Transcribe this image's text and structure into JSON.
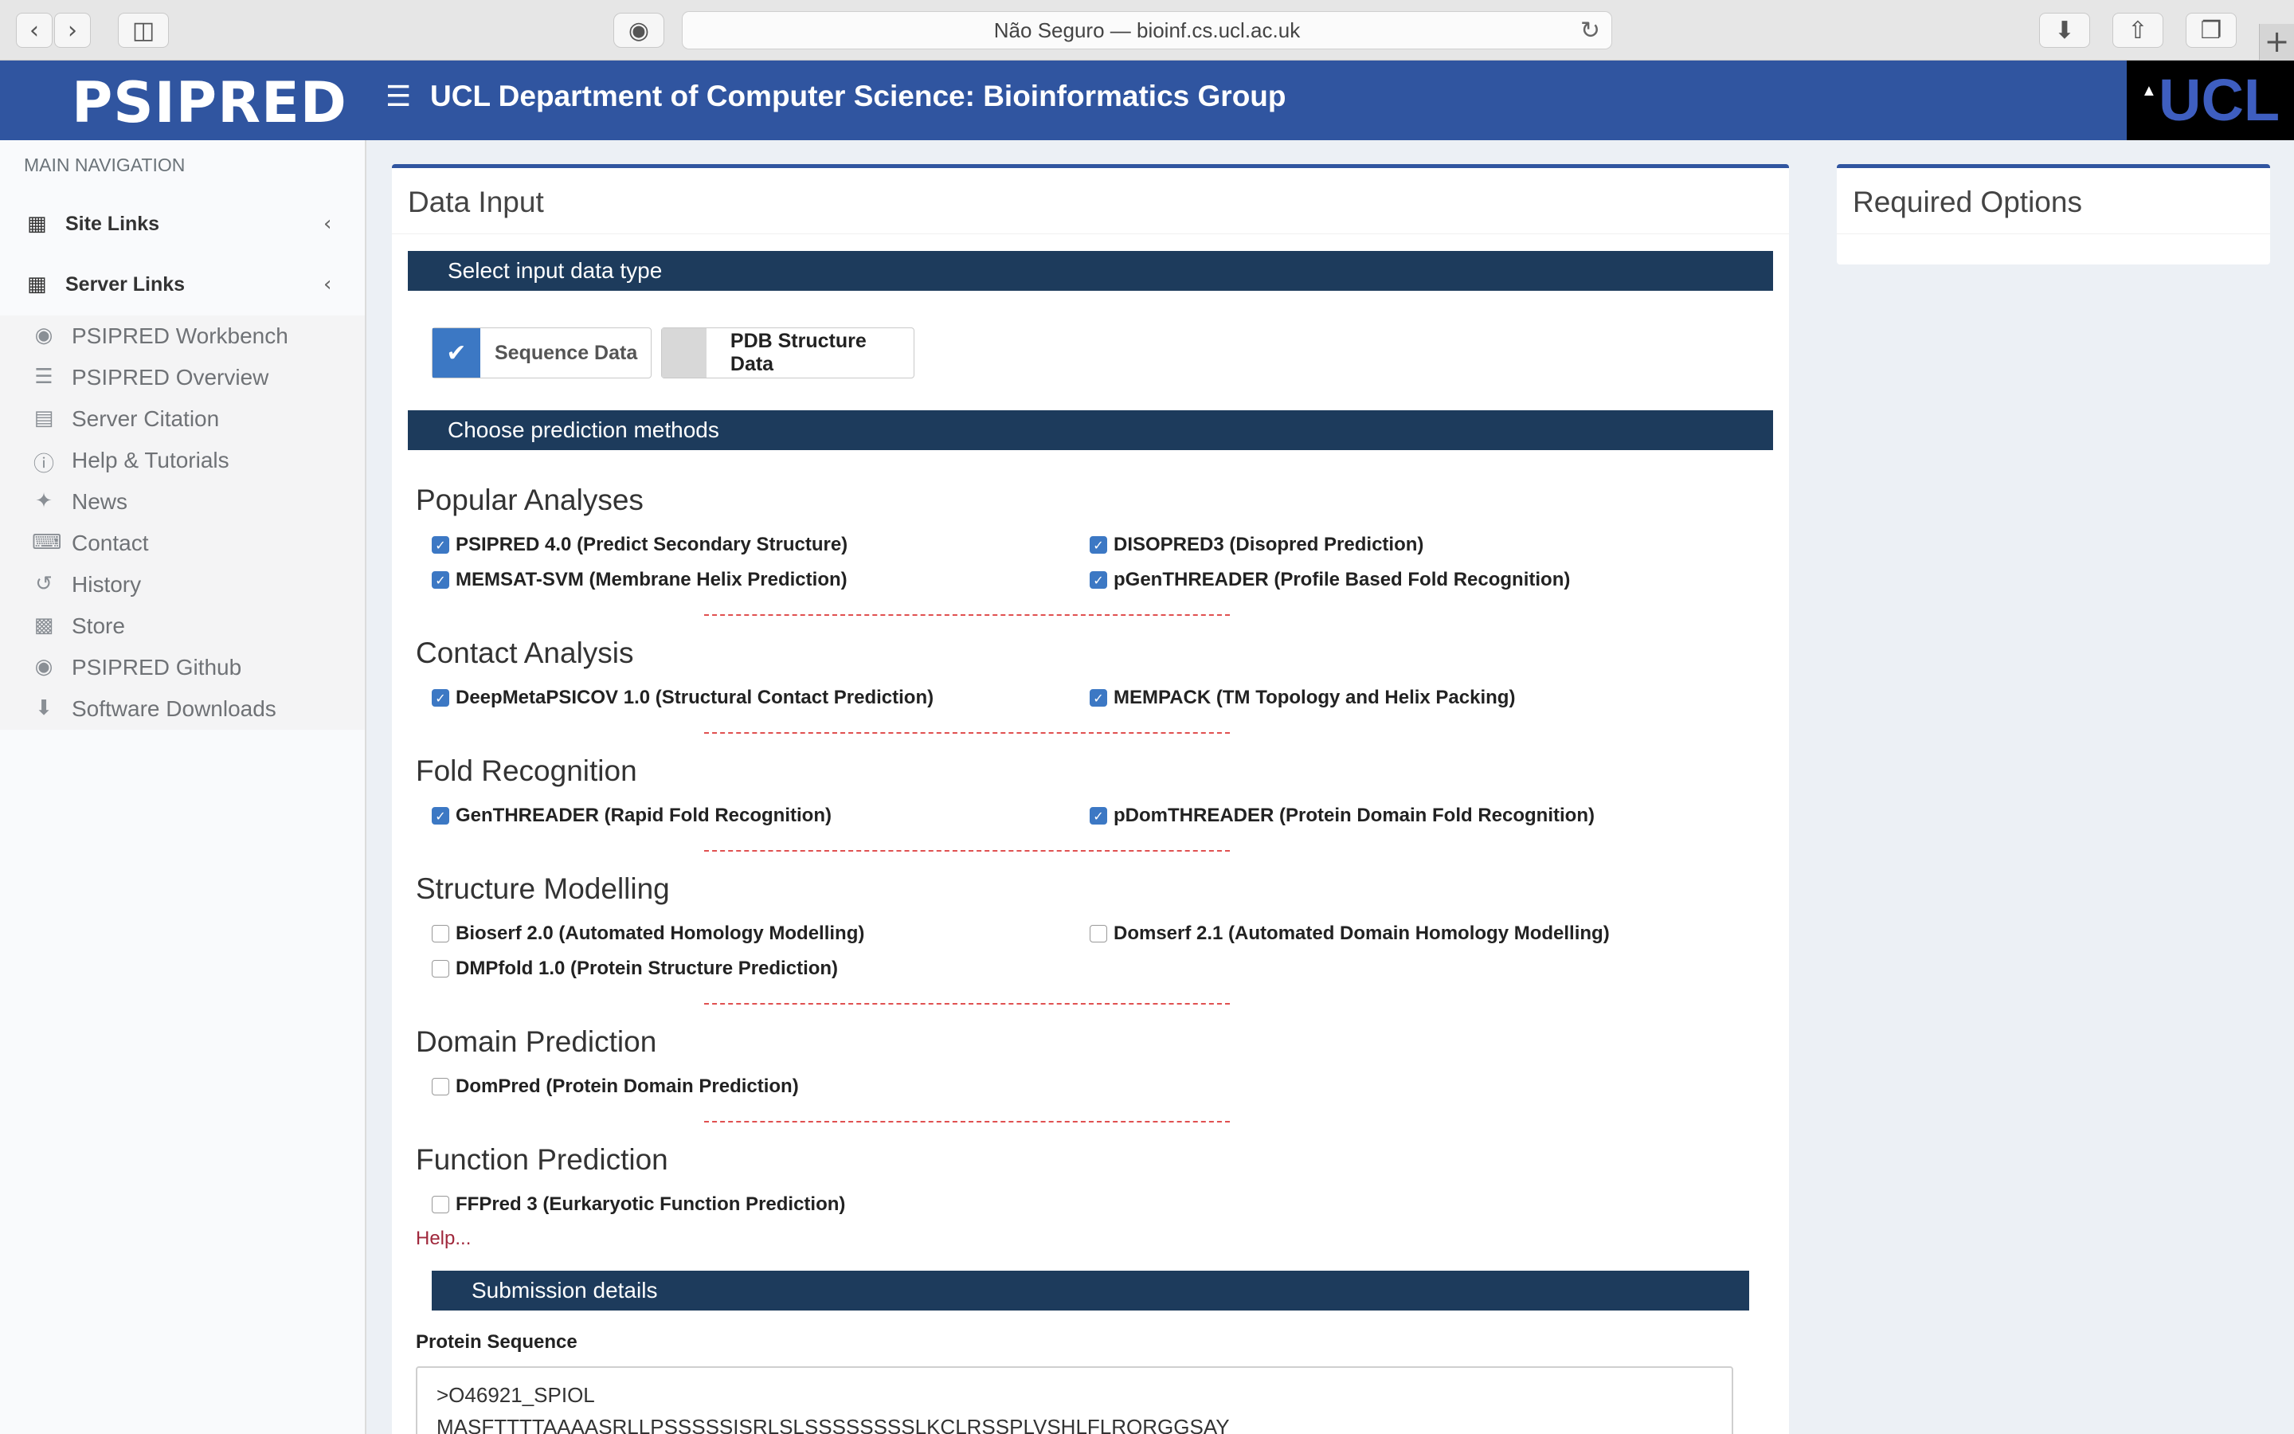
{
  "browser": {
    "url_text": "Não Seguro — bioinf.cs.ucl.ac.uk"
  },
  "header": {
    "logo": "PSIPRED",
    "title": "UCL Department of Computer Science: Bioinformatics Group",
    "ucl_logo": "UCL"
  },
  "sidebar": {
    "heading": "MAIN NAVIGATION",
    "groups": [
      {
        "label": "Site Links"
      },
      {
        "label": "Server Links"
      }
    ],
    "items": [
      {
        "label": "PSIPRED Workbench",
        "icon": "dashboard-icon"
      },
      {
        "label": "PSIPRED Overview",
        "icon": "list-icon"
      },
      {
        "label": "Server Citation",
        "icon": "file-icon"
      },
      {
        "label": "Help & Tutorials",
        "icon": "question-icon"
      },
      {
        "label": "News",
        "icon": "twitter-icon"
      },
      {
        "label": "Contact",
        "icon": "keyboard-icon"
      },
      {
        "label": "History",
        "icon": "history-icon"
      },
      {
        "label": "Store",
        "icon": "cart-icon"
      },
      {
        "label": "PSIPRED Github",
        "icon": "github-icon"
      },
      {
        "label": "Software Downloads",
        "icon": "download-icon"
      }
    ]
  },
  "main": {
    "title": "Data Input",
    "input_type_bar": "Select input data type",
    "input_types": [
      {
        "label": "Sequence Data",
        "selected": true
      },
      {
        "label": "PDB Structure Data",
        "selected": false
      }
    ],
    "methods_bar": "Choose prediction methods",
    "sections": [
      {
        "title": "Popular Analyses",
        "options": [
          {
            "label": "PSIPRED 4.0 (Predict Secondary Structure)",
            "checked": true
          },
          {
            "label": "DISOPRED3 (Disopred Prediction)",
            "checked": true
          },
          {
            "label": "MEMSAT-SVM (Membrane Helix Prediction)",
            "checked": true
          },
          {
            "label": "pGenTHREADER (Profile Based Fold Recognition)",
            "checked": true
          }
        ]
      },
      {
        "title": "Contact Analysis",
        "options": [
          {
            "label": "DeepMetaPSICOV 1.0 (Structural Contact Prediction)",
            "checked": true
          },
          {
            "label": "MEMPACK (TM Topology and Helix Packing)",
            "checked": true
          }
        ]
      },
      {
        "title": "Fold Recognition",
        "options": [
          {
            "label": "GenTHREADER (Rapid Fold Recognition)",
            "checked": true
          },
          {
            "label": "pDomTHREADER (Protein Domain Fold Recognition)",
            "checked": true
          }
        ]
      },
      {
        "title": "Structure Modelling",
        "options": [
          {
            "label": "Bioserf 2.0 (Automated Homology Modelling)",
            "checked": false
          },
          {
            "label": "Domserf 2.1 (Automated Domain Homology Modelling)",
            "checked": false
          },
          {
            "label": "DMPfold 1.0 (Protein Structure Prediction)",
            "checked": false
          }
        ]
      },
      {
        "title": "Domain Prediction",
        "options": [
          {
            "label": "DomPred (Protein Domain Prediction)",
            "checked": false
          }
        ]
      },
      {
        "title": "Function Prediction",
        "options": [
          {
            "label": "FFPred 3 (Eurkaryotic Function Prediction)",
            "checked": false
          }
        ]
      }
    ],
    "help_link": "Help...",
    "submission_bar": "Submission details",
    "sequence_label": "Protein Sequence",
    "sequence_value": ">O46921_SPIOL\nMASFTTTTAAAASRLLPSSSSSISRLSLSSSSSSSSLKCLRSSPLVSHLFLRQRGGSAY"
  },
  "right_panel": {
    "title": "Required Options"
  }
}
